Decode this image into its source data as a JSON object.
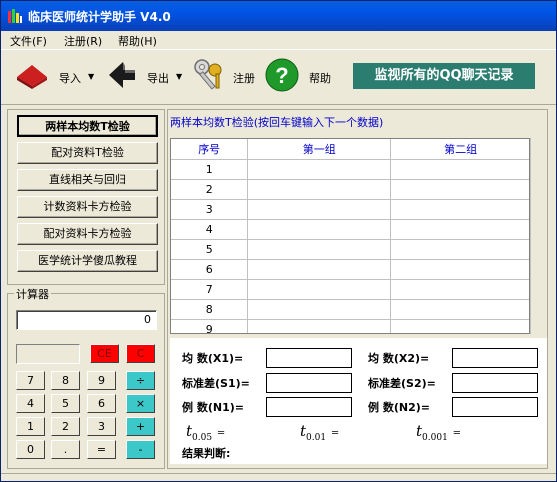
{
  "window": {
    "title": "临床医师统计学助手 V4.0"
  },
  "menu": {
    "items": [
      "文件(F)",
      "注册(R)",
      "帮助(H)"
    ]
  },
  "toolbar": {
    "import_label": "导入",
    "export_label": "导出",
    "register_label": "注册",
    "help_label": "帮助",
    "banner_text": "监视所有的QQ聊天记录"
  },
  "functions": {
    "items": [
      "两样本均数T检验",
      "配对资料T检验",
      "直线相关与回归",
      "计数资料卡方检验",
      "配对资料卡方检验",
      "医学统计学傻瓜教程"
    ]
  },
  "calculator": {
    "title": "计算器",
    "display": "0",
    "keys": {
      "ce": "CE",
      "c": "C",
      "k7": "7",
      "k8": "8",
      "k9": "9",
      "div": "÷",
      "k4": "4",
      "k5": "5",
      "k6": "6",
      "mul": "×",
      "k1": "1",
      "k2": "2",
      "k3": "3",
      "add": "+",
      "k0": "0",
      "dot": ".",
      "eq": "=",
      "sub": "-"
    }
  },
  "panel": {
    "header": "两样本均数T检验(按回车键输入下一个数据)",
    "columns": [
      "序号",
      "第一组",
      "第二组"
    ],
    "rows": [
      "1",
      "2",
      "3",
      "4",
      "5",
      "6",
      "7",
      "8",
      "9"
    ]
  },
  "stats": {
    "mean1": "均  数(X1)=",
    "mean2": "均  数(X2)=",
    "sd1": "标准差(S1)=",
    "sd2": "标准差(S2)=",
    "n1": "例  数(N1)=",
    "n2": "例  数(N2)=",
    "t05": "0.05",
    "t01": "0.01",
    "t001": "0.001",
    "t_letter": "t",
    "eq": "=",
    "result": "结果判断:"
  },
  "colors": {
    "titlebar": "#0054e3",
    "banner": "#2b7d6f",
    "key_red": "#ff0000",
    "key_cyan": "#3cc8c8",
    "header_text": "#0000cc"
  }
}
